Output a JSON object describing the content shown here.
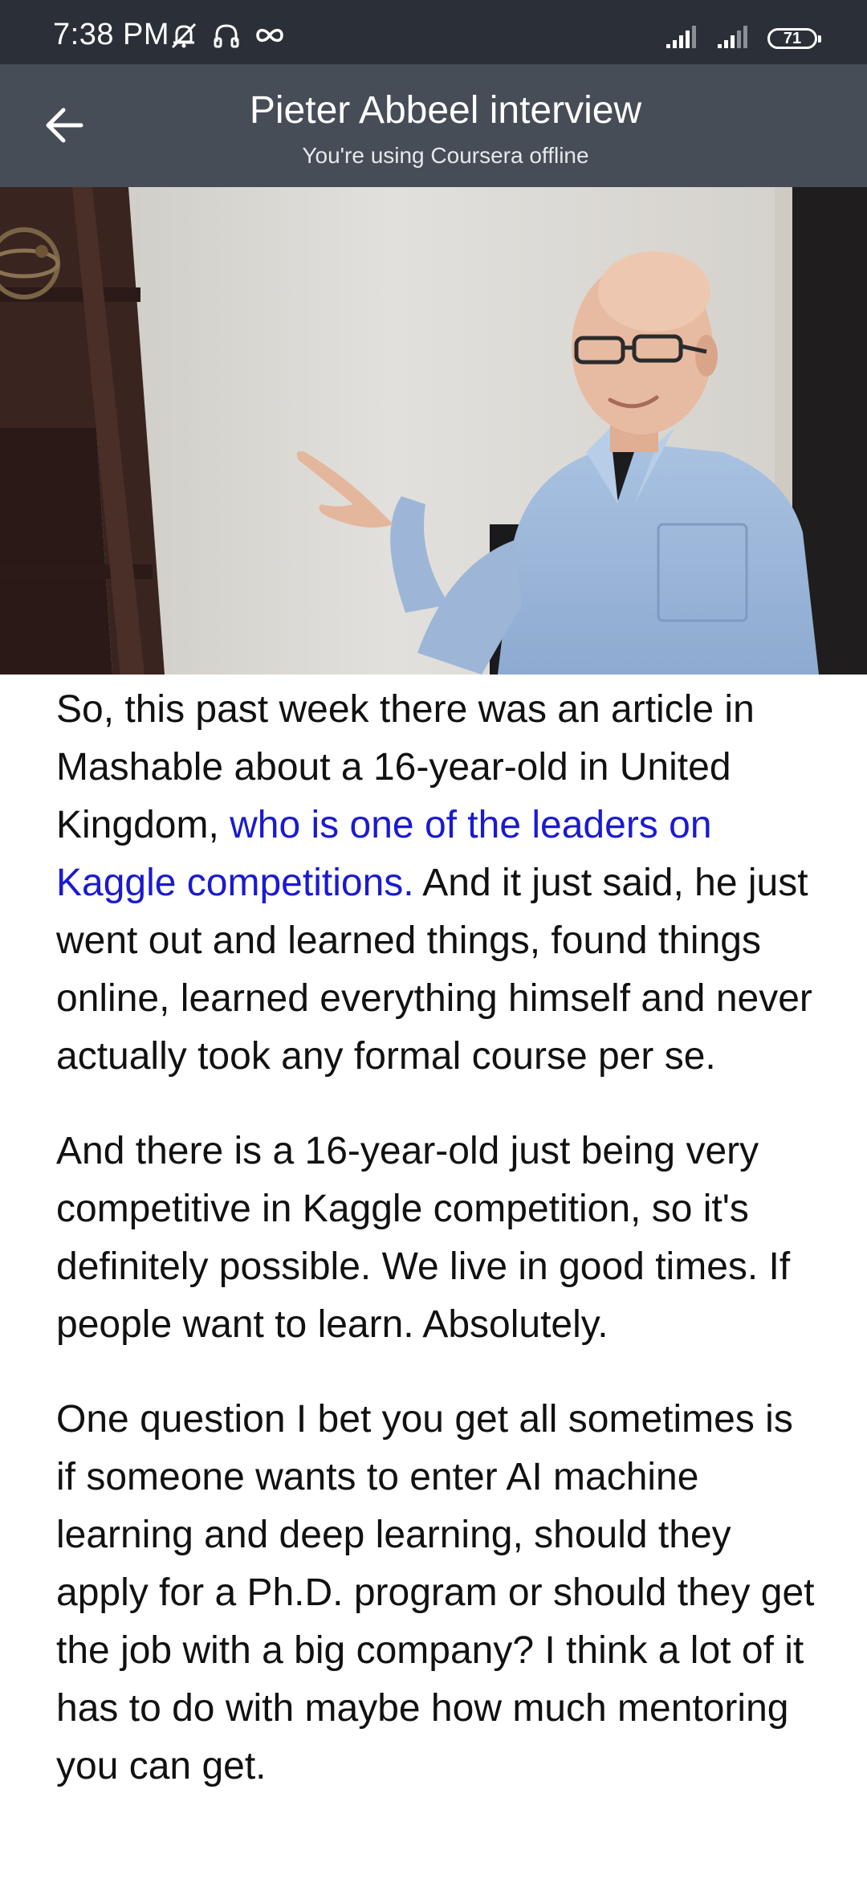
{
  "status_bar": {
    "time": "7:38 PM",
    "battery_level": "71",
    "icons": [
      "mute-icon",
      "headset-icon",
      "infinity-icon",
      "signal-icon",
      "signal-icon",
      "battery-icon"
    ]
  },
  "header": {
    "title": "Pieter Abbeel interview",
    "subtitle": "You're using Coursera offline",
    "back_icon": "arrow-left-icon"
  },
  "video": {
    "description_icon": "video-player"
  },
  "transcript": {
    "p1_before": "So, this past week there was an article in Mashable about a 16-year-old in United Kingdom, ",
    "p1_highlight": "who is one of the leaders on Kaggle competitions.",
    "p1_after": " And it just said, he just went out and learned things, found things online, learned everything himself and never actually took any formal course per se.",
    "p2": "And there is a 16-year-old just being very competitive in Kaggle competition, so it's definitely possible. We live in good times. If people want to learn. Absolutely.",
    "p3": "One question I bet you get all sometimes is if someone wants to enter AI machine learning and deep learning, should they apply for a Ph.D. program or should they get the job with a big company? I think a lot of it has to do with maybe how much mentoring you can get."
  },
  "colors": {
    "status_bar": "#2b3038",
    "app_bar": "#464d57",
    "highlight": "#1a1ad0",
    "text": "#111111"
  }
}
